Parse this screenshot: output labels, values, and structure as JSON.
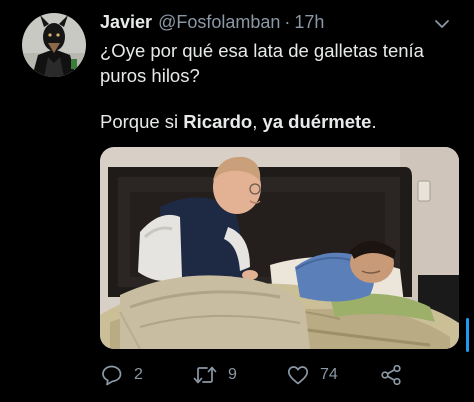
{
  "tweet": {
    "author": {
      "name": "Javier",
      "handle": "@Fosfolamban",
      "separator": "·",
      "time": "17h"
    },
    "text": {
      "line1": "¿Oye por qué esa lata de galletas tenía puros hilos?",
      "line2_pre": "Porque si ",
      "line2_bold1": "Ricardo",
      "line2_mid": ", ",
      "line2_bold2": "ya duérmete",
      "line2_post": "."
    },
    "actions": {
      "replies": "2",
      "retweets": "9",
      "likes": "74"
    }
  },
  "icons": {
    "more": "chevron-down-icon",
    "reply": "reply-icon",
    "retweet": "retweet-icon",
    "like": "heart-icon",
    "share": "share-icon"
  },
  "colors": {
    "background": "#000000",
    "text": "#e7e9ea",
    "secondary": "#8b98a5",
    "accent": "#1d9bf0"
  }
}
